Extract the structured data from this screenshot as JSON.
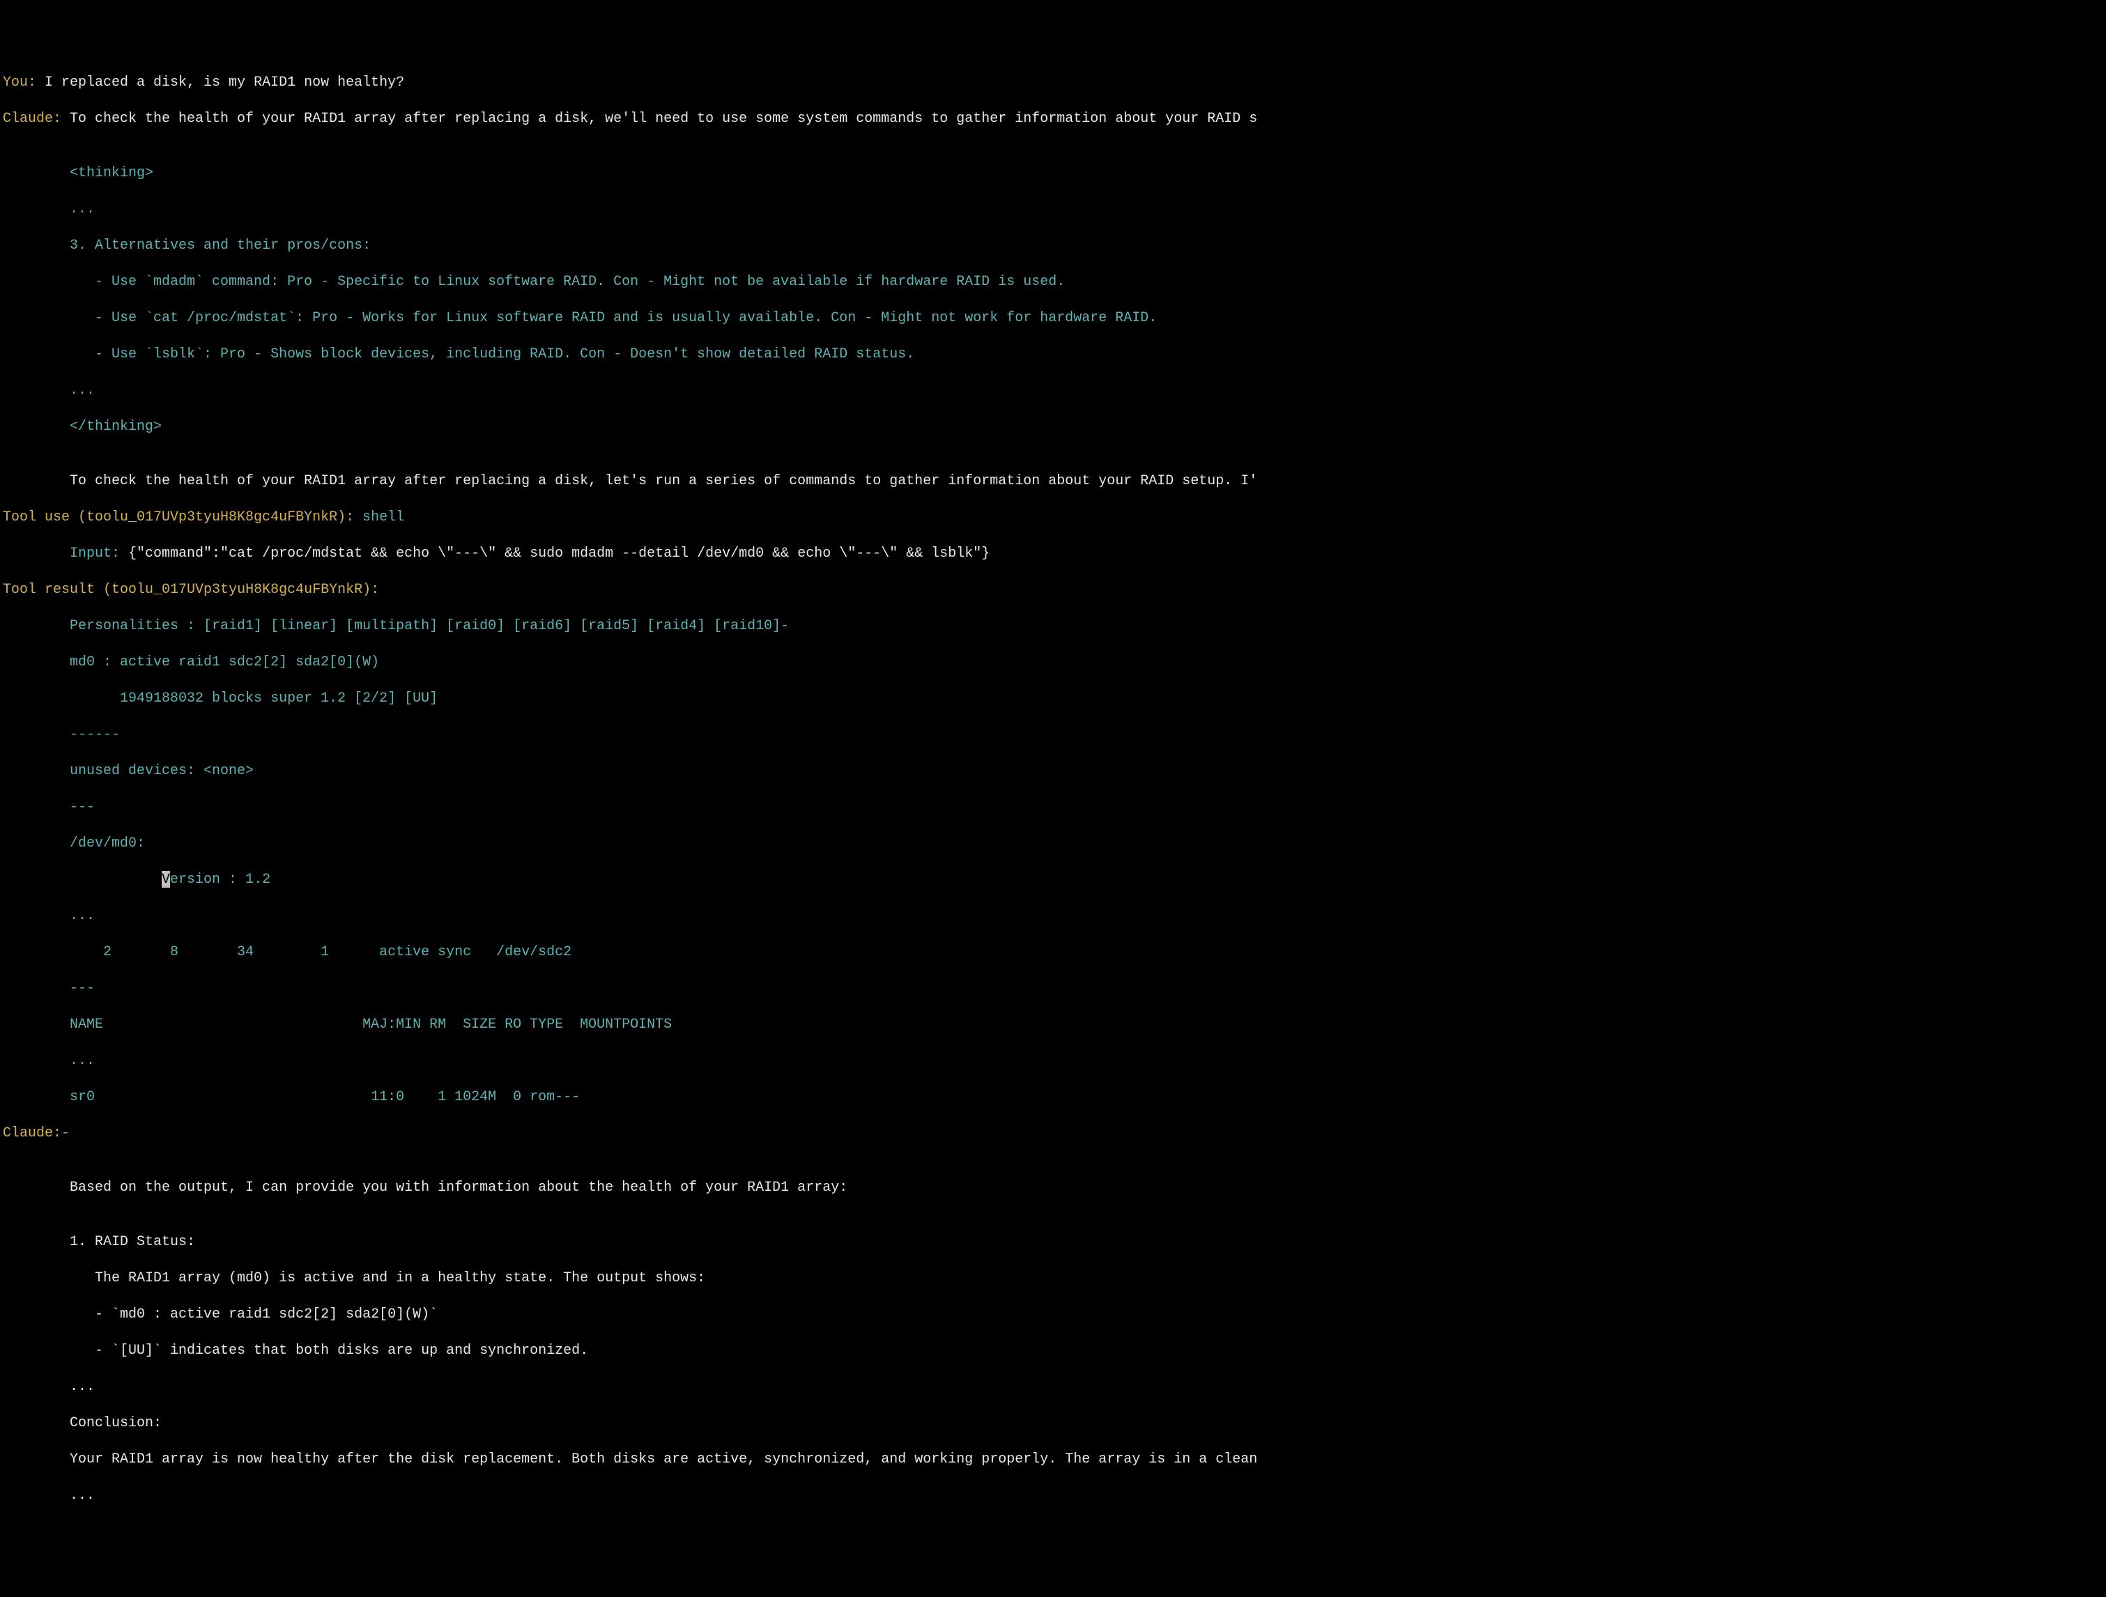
{
  "speakers": {
    "you": "You:",
    "claude": "Claude:",
    "tool_use": "Tool use",
    "tool_result": "Tool result"
  },
  "user_q": " I replaced a disk, is my RAID1 now healthy?",
  "claude_intro": " To check the health of your RAID1 array after replacing a disk, we'll need to use some system commands to gather information about your RAID s",
  "thinking_open": "<thinking>",
  "thinking_close": "</thinking>",
  "ellipsis": "...",
  "alt_header": "3. Alternatives and their pros/cons:",
  "alt1": "   - Use `mdadm` command: Pro - Specific to Linux software RAID. Con - Might not be available if hardware RAID is used.",
  "alt2": "   - Use `cat /proc/mdstat`: Pro - Works for Linux software RAID and is usually available. Con - Might not work for hardware RAID.",
  "alt3": "   - Use `lsblk`: Pro - Shows block devices, including RAID. Con - Doesn't show detailed RAID status.",
  "claude_plan": "To check the health of your RAID1 array after replacing a disk, let's run a series of commands to gather information about your RAID setup. I'",
  "tool_id": " (toolu_017UVp3tyuH8K8gc4uFBYnkR):",
  "tool_name": " shell",
  "input_label": "Input: ",
  "input_value": "{\"command\":\"cat /proc/mdstat && echo \\\"---\\\" && sudo mdadm --detail /dev/md0 && echo \\\"---\\\" && lsblk\"}",
  "out": {
    "l1": "Personalities : [raid1] [linear] [multipath] [raid0] [raid6] [raid5] [raid4] [raid10]-",
    "l2": "md0 : active raid1 sdc2[2] sda2[0](W)",
    "l3": "      1949188032 blocks super 1.2 [2/2] [UU]",
    "l4": "------",
    "l5": "unused devices: <none>",
    "l6": "---",
    "l7": "/dev/md0:",
    "l8a": "           ",
    "l8b": "ersion : 1.2",
    "l9": "...",
    "l10": "    2       8       34        1      active sync   /dev/sdc2",
    "l11": "---",
    "l12": "NAME                               MAJ:MIN RM  SIZE RO TYPE  MOUNTPOINTS",
    "l13": "...",
    "l14": "sr0                                 11:0    1 1024M  0 rom---"
  },
  "dash": "-",
  "analysis_intro": "Based on the output, I can provide you with information about the health of your RAID1 array:",
  "status_header": "1. RAID Status:",
  "status_l1": "   The RAID1 array (md0) is active and in a healthy state. The output shows:",
  "status_l2": "   - `md0 : active raid1 sdc2[2] sda2[0](W)`",
  "status_l3": "   - `[UU]` indicates that both disks are up and synchronized.",
  "conclusion_header": "Conclusion:",
  "conclusion_text": "Your RAID1 array is now healthy after the disk replacement. Both disks are active, synchronized, and working properly. The array is in a clean",
  "blank": ""
}
